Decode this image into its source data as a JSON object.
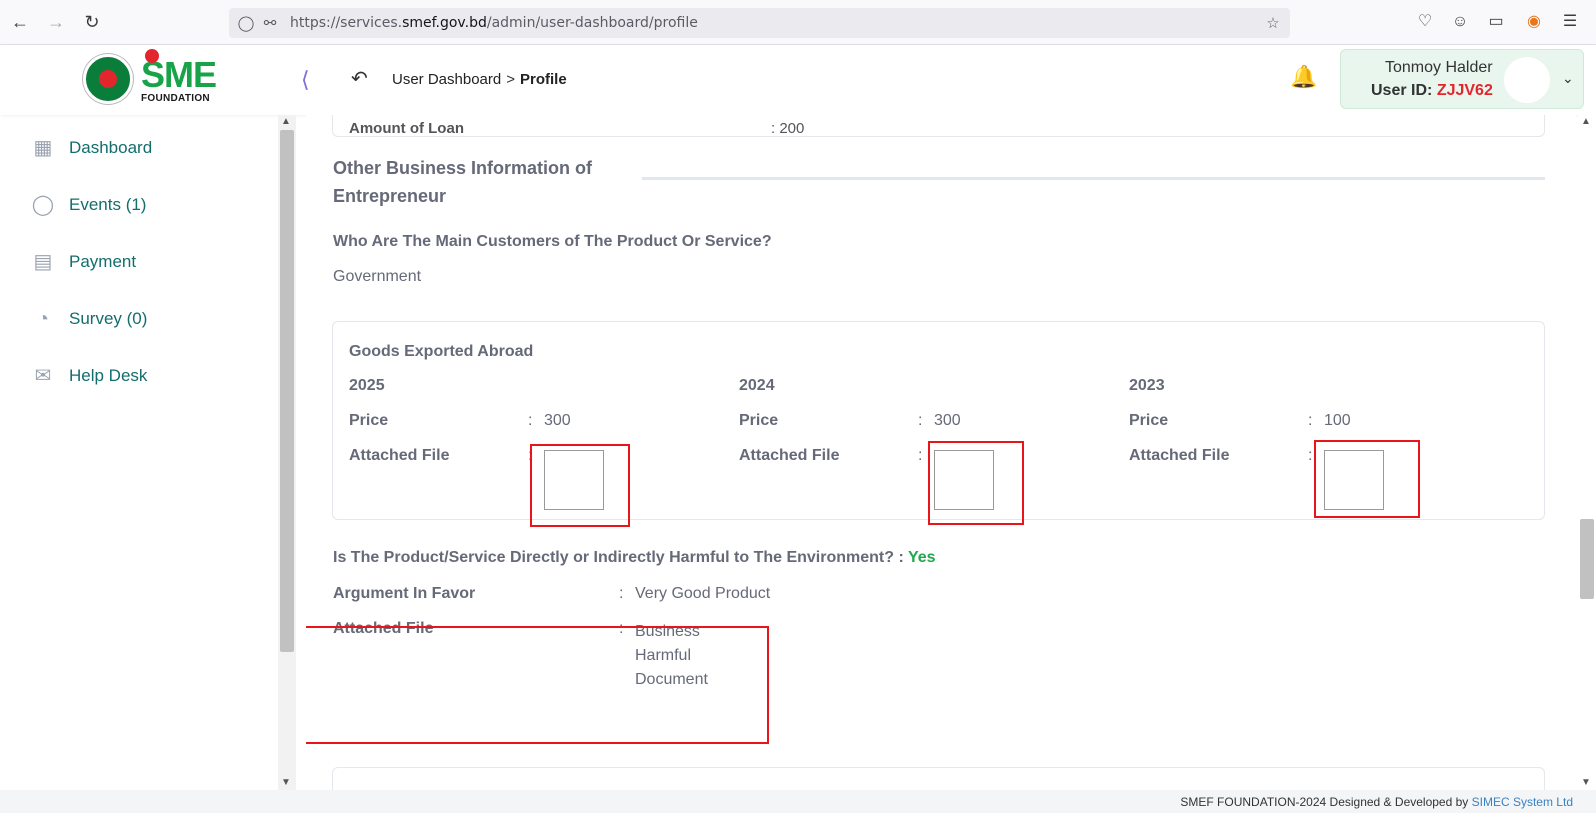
{
  "browser": {
    "url_prefix": "https://services.",
    "url_domain": "smef.gov.bd",
    "url_path": "/admin/user-dashboard/profile"
  },
  "header": {
    "logo_text": "SME",
    "logo_subtext": "FOUNDATION",
    "breadcrumb_parent": "User Dashboard",
    "breadcrumb_sep": ">",
    "breadcrumb_current": "Profile",
    "user_name": "Tonmoy Halder",
    "user_id_label": "User ID:",
    "user_id_value": "ZJJV62"
  },
  "sidebar": {
    "items": [
      {
        "label": "Dashboard",
        "icon": "grid-icon"
      },
      {
        "label": "Events (1)",
        "icon": "lock-circle-icon"
      },
      {
        "label": "Payment",
        "icon": "money-icon"
      },
      {
        "label": "Survey (0)",
        "icon": "pie-chart-icon"
      },
      {
        "label": "Help Desk",
        "icon": "mail-icon"
      }
    ]
  },
  "main": {
    "top_card_label": "Amount of Loan",
    "top_card_value": ": 200",
    "section_title": "Other Business Information of Entrepreneur",
    "customers_question": "Who Are The Main Customers of The Product Or Service?",
    "customers_answer": "Government",
    "goods": {
      "title": "Goods Exported Abroad",
      "colon": ":",
      "price_label": "Price",
      "file_label": "Attached File",
      "years": [
        {
          "year": "2025",
          "price": "300"
        },
        {
          "year": "2024",
          "price": "300"
        },
        {
          "year": "2023",
          "price": "100"
        }
      ]
    },
    "harm_question": "Is The Product/Service Directly or Indirectly Harmful to The Environment? :",
    "harm_answer": "Yes",
    "colon": ":",
    "argument_label": "Argument In Favor",
    "argument_value": "Very Good Product",
    "attached_label": "Attached File",
    "attached_value": "Business Harmful Document"
  },
  "footer": {
    "text": "SMEF FOUNDATION-2024    Designed & Developed by",
    "link": "SIMEC System Ltd"
  },
  "colors": {
    "accent_green": "#18a349",
    "brand_red": "#e3262d",
    "sidebar_text": "#136d6d",
    "highlight_red": "#e8161b"
  }
}
